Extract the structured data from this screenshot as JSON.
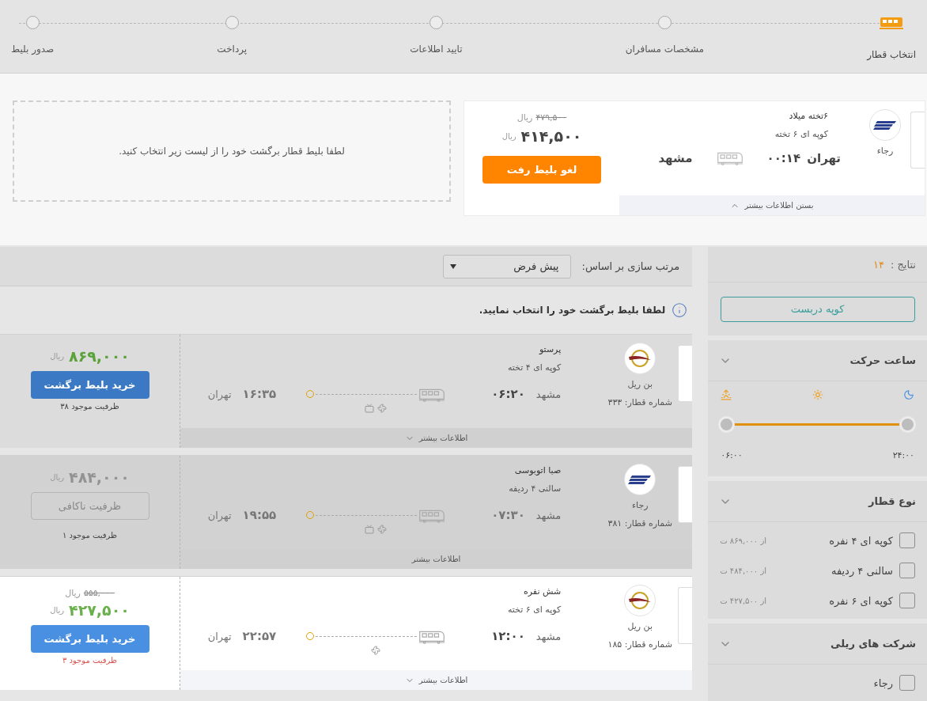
{
  "steps": [
    {
      "label": "انتخاب قطار",
      "selected": true
    },
    {
      "label": "مشخصات مسافران",
      "selected": false
    },
    {
      "label": "تایید اطلاعات",
      "selected": false
    },
    {
      "label": "پرداخت",
      "selected": false
    },
    {
      "label": "صدور بلیط",
      "selected": false
    }
  ],
  "outbound_ticket": {
    "logo": {
      "kind": "stripes"
    },
    "company": "رجاء",
    "train_name": "۶تخته میلاد",
    "coach_type": "کوپه ای ۶ تخته",
    "origin": "تهران",
    "departure_time": "۰۰:۱۴",
    "destination": "مشهد",
    "toggle": "بستن اطلاعات بیشتر",
    "expanded": true,
    "old_price": "۴۷۹,۵۰۰",
    "old_currency": "ریال",
    "price": "۴۱۴,۵۰۰",
    "currency": "ریال",
    "cancel_button": "لغو بلیط رفت"
  },
  "return_placeholder": "لطفا بلیط قطار برگشت خود را از لیست زیر انتخاب کنید.",
  "sort": {
    "label": "مرتب سازی بر اساس:",
    "value": "پیش فرض"
  },
  "notice": "لطفا بلیط برگشت خود را انتخاب نمایید.",
  "results": [
    {
      "logo": {
        "kind": "ring"
      },
      "company": "بن ریل",
      "train_number": "شماره قطار: ۳۳۳",
      "train_name": "پرستو",
      "coach_type": "کوپه ای ۴ تخته",
      "origin": "مشهد",
      "departure_time": "۰۶:۲۰",
      "arrival_time": "۱۶:۳۵",
      "destination": "تهران",
      "amenities": [
        {
          "kind": "fan"
        },
        {
          "kind": "tv"
        }
      ],
      "price": "۸۶۹,۰۰۰",
      "currency": "ریال",
      "button": {
        "kind": "buy",
        "label": "خرید بلیط برگشت"
      },
      "capacity": "ظرفیت موجود ۳۸",
      "capacity_low": false,
      "toggle": "اطلاعات بیشتر",
      "disabled": false,
      "highlighted": false
    },
    {
      "logo": {
        "kind": "stripes"
      },
      "company": "رجاء",
      "train_number": "شماره قطار: ۳۸۱",
      "train_name": "صبا اتوبوسی",
      "coach_type": "سالنی ۴ ردیفه",
      "origin": "مشهد",
      "departure_time": "۰۷:۳۰",
      "arrival_time": "۱۹:۵۵",
      "destination": "تهران",
      "amenities": [
        {
          "kind": "fan"
        },
        {
          "kind": "tv"
        }
      ],
      "price": "۴۸۴,۰۰۰",
      "currency": "ریال",
      "button": {
        "kind": "unavailable",
        "label": "ظرفیت ناکافی"
      },
      "capacity": "ظرفیت موجود ۱",
      "capacity_low": false,
      "toggle": "اطلاعات بیشتر",
      "disabled": true,
      "highlighted": false
    },
    {
      "logo": {
        "kind": "ring"
      },
      "company": "بن ریل",
      "train_number": "شماره قطار: ۱۸۵",
      "train_name": "شش نفره",
      "coach_type": "کوپه ای ۶ تخته",
      "origin": "مشهد",
      "departure_time": "۱۲:۰۰",
      "arrival_time": "۲۲:۵۷",
      "destination": "تهران",
      "amenities": [
        {
          "kind": "fan"
        }
      ],
      "old_price": "۵۵۵,۰۰۰",
      "old_currency": "ریال",
      "price": "۴۲۷,۵۰۰",
      "currency": "ریال",
      "button": {
        "kind": "buy",
        "label": "خرید بلیط برگشت"
      },
      "capacity": "ظرفیت موجود ۳",
      "capacity_low": true,
      "toggle": "اطلاعات بیشتر",
      "disabled": false,
      "highlighted": true
    }
  ],
  "sidebar": {
    "results_label": "نتایج :",
    "results_count": "۱۴",
    "coupe_button": "کوپه دربست",
    "filters": [
      {
        "kind": "time",
        "title": "ساعت حرکت",
        "expanded": true,
        "level": 1,
        "labels": [
          "۲۴:۰۰",
          "۰۶:۰۰"
        ]
      },
      {
        "kind": "checklist",
        "title": "نوع قطار",
        "expanded": true,
        "options": [
          {
            "label": "کوپه ای ۴ نفره",
            "from": "از ۸۶۹,۰۰۰ ت",
            "checked": false
          },
          {
            "label": "سالنی ۴ ردیفه",
            "from": "از ۴۸۴,۰۰۰ ت",
            "checked": false
          },
          {
            "label": "کوپه ای ۶ نفره",
            "from": "از ۴۲۷,۵۰۰ ت",
            "checked": false
          }
        ]
      },
      {
        "kind": "checklist",
        "title": "شرکت های ریلی",
        "expanded": true,
        "options": [
          {
            "label": "رجاء",
            "checked": false
          }
        ]
      }
    ]
  }
}
